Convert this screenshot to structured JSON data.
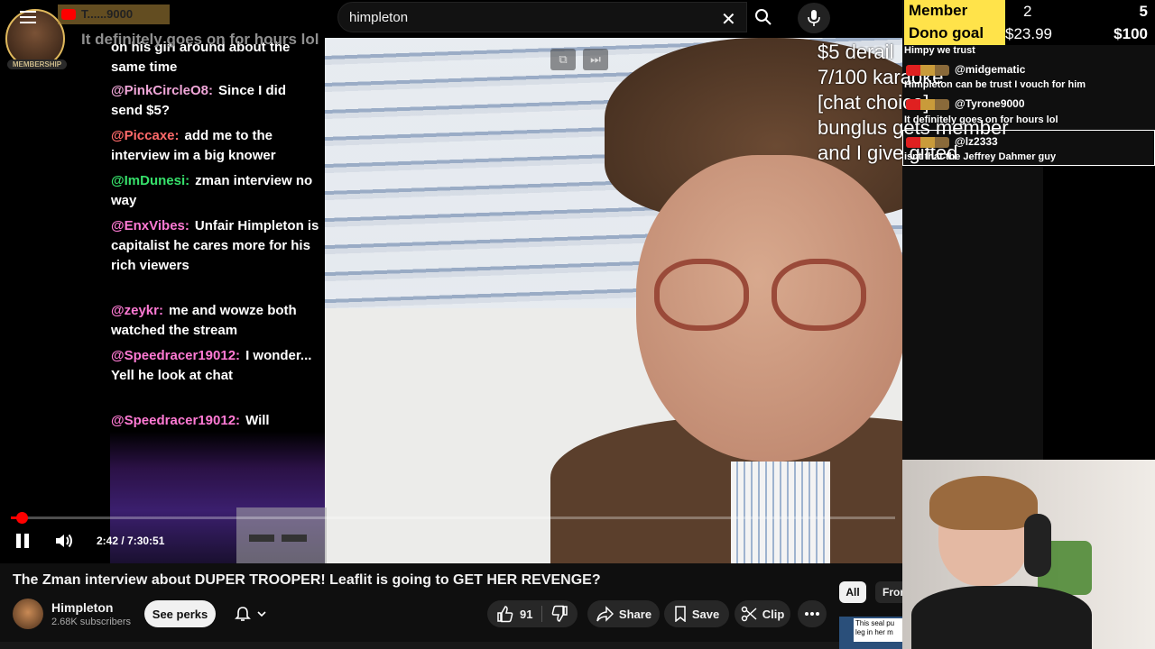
{
  "search": {
    "query": "himpleton"
  },
  "top_badge": {
    "name": "T......9000"
  },
  "membership_label": "MEMBERSHIP",
  "overlay_line": "It definitely goes on for hours lol",
  "left_chat": {
    "snippet": "on his girl around about the same time",
    "messages": [
      {
        "author": "@PinkCircleO8:",
        "author_color": "#f0a6d8",
        "text": "Since I did send $5?"
      },
      {
        "author": "@Piccaxe:",
        "author_color": "#ff6a6a",
        "text": "add me to the interview im a big knower"
      },
      {
        "author": "@ImDunesi:",
        "author_color": "#36e06a",
        "text": "zman interview no way"
      },
      {
        "author": "@EnxVibes:",
        "author_color": "#ff7ad4",
        "text": "Unfair Himpleton is capitalist he cares more for his rich viewers"
      },
      {
        "author": "@zeykr:",
        "author_color": "#ff7ad4",
        "text": "me and wowze both watched the stream"
      },
      {
        "author": "@Speedracer19012:",
        "author_color": "#ff7ad4",
        "text": "I wonder... Yell he look at chat"
      },
      {
        "author": "@Speedracer19012:",
        "author_color": "#ff7ad4",
        "text": "Will"
      }
    ]
  },
  "goals": {
    "member": {
      "label": "Member Goal",
      "current": "2",
      "target": "5"
    },
    "dono": {
      "label": "Dono goal",
      "current": "$23.99",
      "target": "$100"
    }
  },
  "overlay_text": [
    "$5 derail",
    "7/100 karaoke",
    "[chat choice]",
    "bunglus gets member",
    "and I give gifted"
  ],
  "side_chat": {
    "lines": [
      {
        "type": "text",
        "text": "Himpy we trust"
      },
      {
        "type": "name",
        "text": "@midgematic"
      },
      {
        "type": "text",
        "text": "Himpleton can be trust I vouch for him"
      },
      {
        "type": "name",
        "text": "@Tyrone9000"
      },
      {
        "type": "text",
        "text": "It definitely goes on for hours lol"
      },
      {
        "type": "name",
        "text": "@lz2333"
      },
      {
        "type": "text",
        "text": "isnt that the Jeffrey Dahmer guy"
      }
    ]
  },
  "player": {
    "time": "2:42 / 7:30:51",
    "progress_fraction": 0.006
  },
  "video": {
    "title": "The Zman interview about DUPER TROOPER! Leaflit is going to GET HER REVENGE?",
    "channel": "Himpleton",
    "subscribers": "2.68K subscribers",
    "see_perks": "See perks",
    "likes": "91",
    "share": "Share",
    "save": "Save",
    "clip": "Clip"
  },
  "chips": {
    "all": "All",
    "from": "From"
  },
  "thumbnail_text": "This seal pu leg in her m"
}
